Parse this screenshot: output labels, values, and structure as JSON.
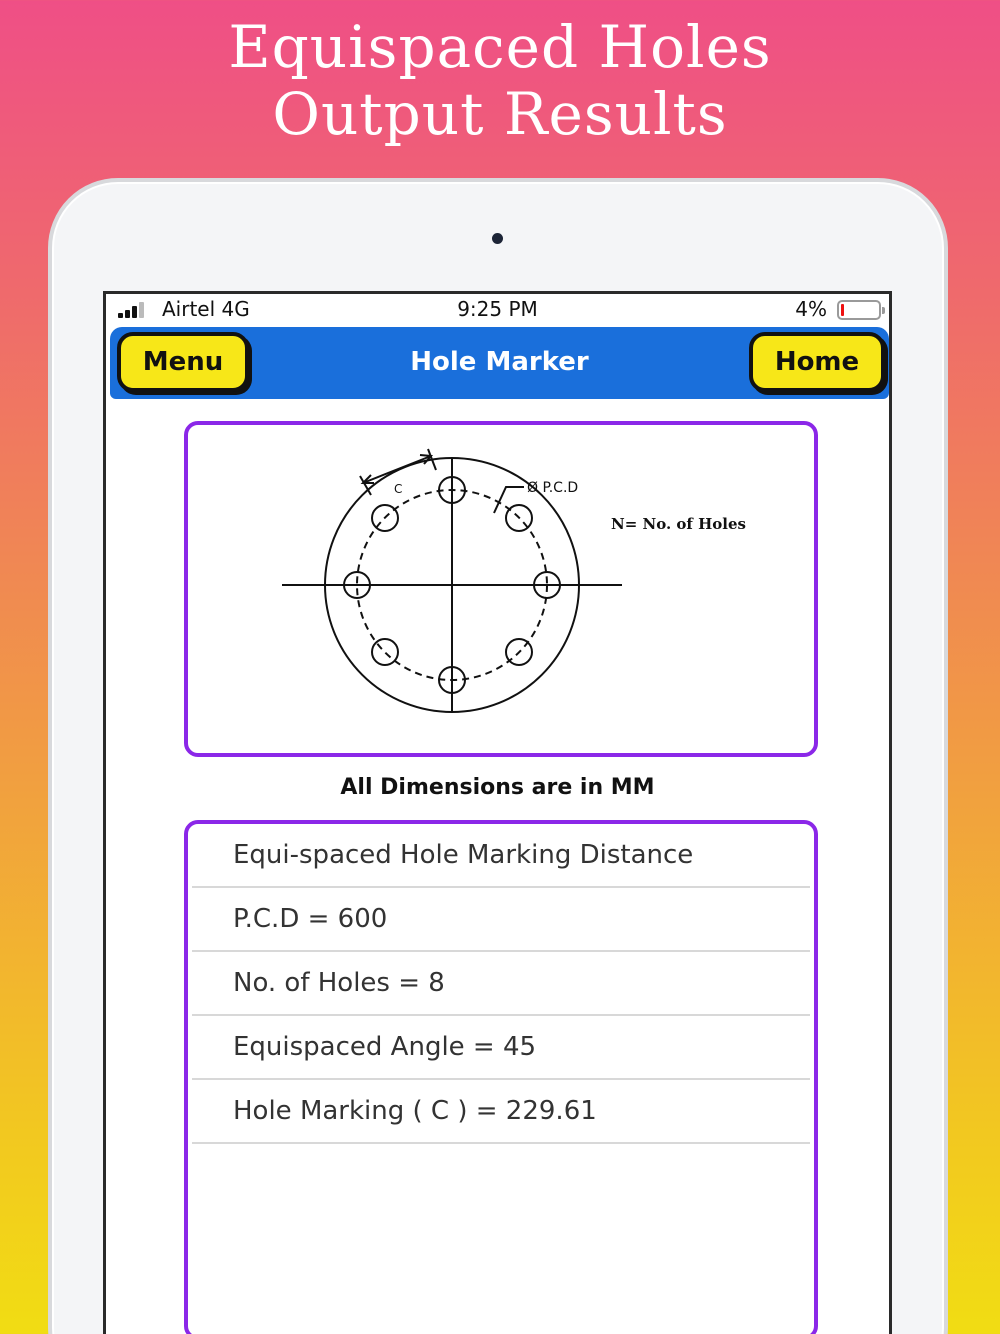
{
  "promo": {
    "title_line1": "Equispaced Holes",
    "title_line2": "Output Results"
  },
  "status_bar": {
    "carrier": "Airtel 4G",
    "time": "9:25 PM",
    "battery_percent": "4%",
    "battery_level": 0.04
  },
  "nav": {
    "title": "Hole Marker",
    "menu_label": "Menu",
    "home_label": "Home",
    "color": "#1a6fdb",
    "button_color": "#f7e718"
  },
  "diagram": {
    "label_c": "C",
    "label_pcd": "Ø P.C.D",
    "label_n": "N= No. of Holes"
  },
  "note": "All Dimensions are in MM",
  "results": {
    "border_color": "#8b27e8",
    "rows": [
      "Equi-spaced Hole Marking Distance",
      "P.C.D = 600",
      "No. of Holes = 8",
      "Equispaced Angle = 45",
      "Hole Marking ( C ) = 229.61"
    ]
  }
}
